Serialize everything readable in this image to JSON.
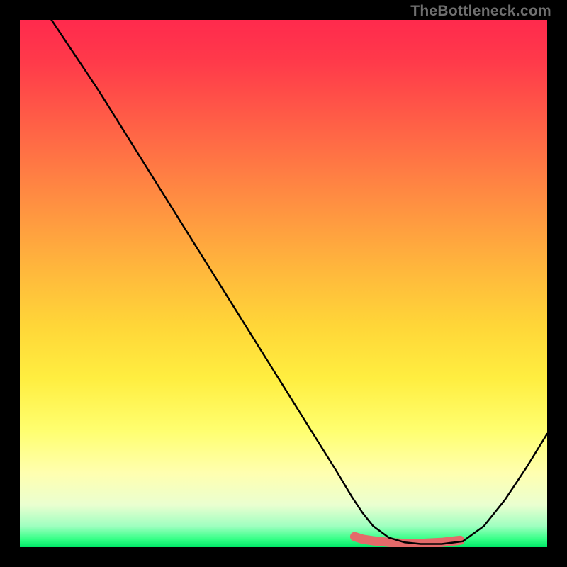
{
  "watermark": "TheBottleneck.com",
  "chart_data": {
    "type": "line",
    "title": "",
    "xlabel": "",
    "ylabel": "",
    "xlim": [
      0,
      100
    ],
    "ylim": [
      0,
      100
    ],
    "series": [
      {
        "name": "curve",
        "x": [
          6,
          10,
          15,
          20,
          25,
          30,
          35,
          40,
          45,
          50,
          55,
          60,
          63,
          65,
          67,
          70,
          73,
          76,
          80,
          84,
          88,
          92,
          96,
          100
        ],
        "y": [
          100,
          94,
          86.5,
          78.5,
          70.5,
          62.5,
          54.5,
          46.5,
          38.5,
          30.5,
          22.5,
          14.5,
          9.5,
          6.5,
          4.0,
          1.8,
          0.9,
          0.6,
          0.6,
          1.1,
          4.0,
          9.0,
          15.0,
          21.5
        ]
      }
    ],
    "highlight_band": {
      "name": "bottom-band",
      "x": [
        63.5,
        65,
        67,
        70,
        73,
        76,
        80,
        83.5
      ],
      "y": [
        2.0,
        1.5,
        1.2,
        0.9,
        0.7,
        0.7,
        0.9,
        1.3
      ]
    },
    "gradient_colors": {
      "top": "#ff2a4d",
      "mid": "#ffd638",
      "bottom": "#00e867"
    }
  }
}
